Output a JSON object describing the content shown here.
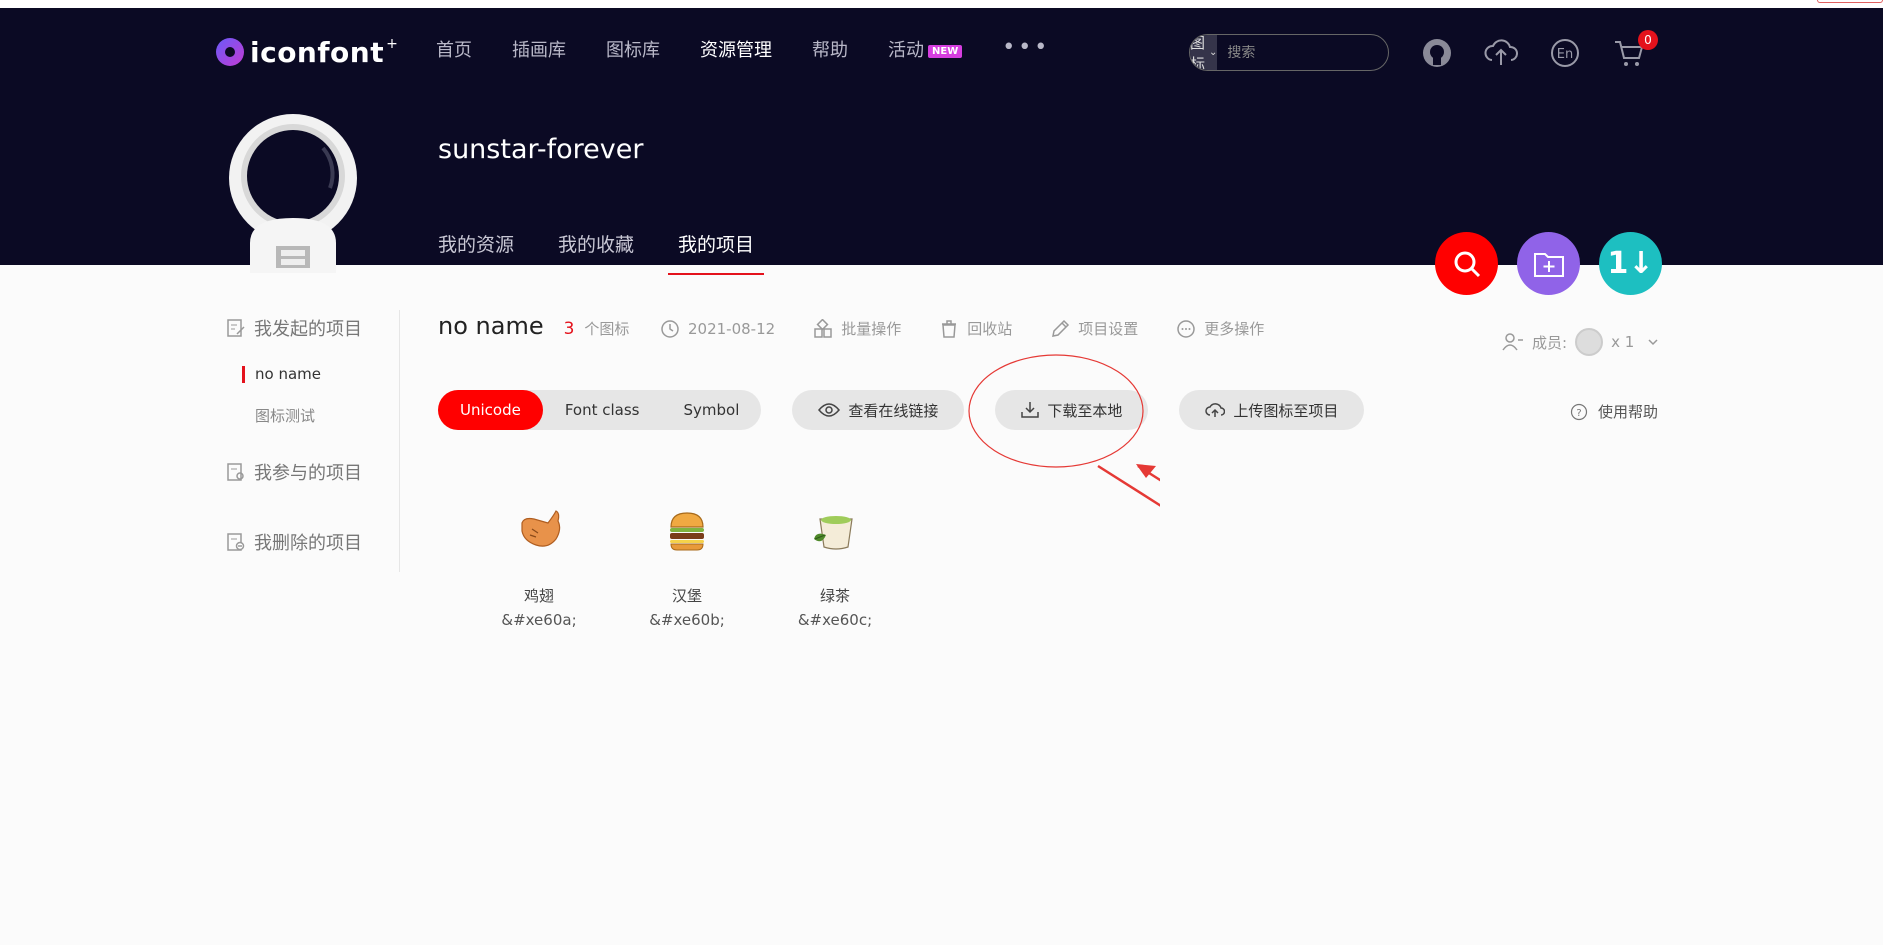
{
  "header": {
    "logo_text": "iconfont",
    "logo_plus": "+",
    "nav": [
      {
        "label": "首页"
      },
      {
        "label": "插画库"
      },
      {
        "label": "图标库"
      },
      {
        "label": "资源管理"
      },
      {
        "label": "帮助"
      },
      {
        "label": "活动"
      }
    ],
    "nav_badge": "NEW",
    "nav_more": "•••",
    "search_select": "图标",
    "search_placeholder": "搜索",
    "cart_count": "0"
  },
  "profile": {
    "username": "sunstar-forever",
    "tabs": [
      {
        "label": "我的资源"
      },
      {
        "label": "我的收藏"
      },
      {
        "label": "我的项目"
      }
    ],
    "fab_sort_label": "1↓"
  },
  "sidebar": {
    "section_created": "我发起的项目",
    "projects": [
      {
        "label": "no name"
      },
      {
        "label": "图标测试"
      }
    ],
    "section_joined": "我参与的项目",
    "section_deleted": "我删除的项目"
  },
  "project": {
    "name": "no name",
    "icon_count": "3",
    "icon_count_label": "个图标",
    "date": "2021-08-12",
    "batch": "批量操作",
    "recycle": "回收站",
    "settings": "项目设置",
    "more": "更多操作",
    "members_label": "成员:",
    "members_count": "x 1",
    "modes": [
      "Unicode",
      "Font class",
      "Symbol"
    ],
    "view_link": "查看在线链接",
    "download": "下载至本地",
    "upload": "上传图标至项目",
    "help": "使用帮助"
  },
  "icons": [
    {
      "name": "鸡翅",
      "code": "&#xe60a;"
    },
    {
      "name": "汉堡",
      "code": "&#xe60b;"
    },
    {
      "name": "绿茶",
      "code": "&#xe60c;"
    }
  ],
  "colors": {
    "header_bg": "#0b0a24",
    "accent_red": "#e4121c",
    "fab_red": "#ff0000",
    "fab_purple": "#9063e8",
    "fab_teal": "#1dbfc1",
    "annotation_red": "#e53935"
  }
}
